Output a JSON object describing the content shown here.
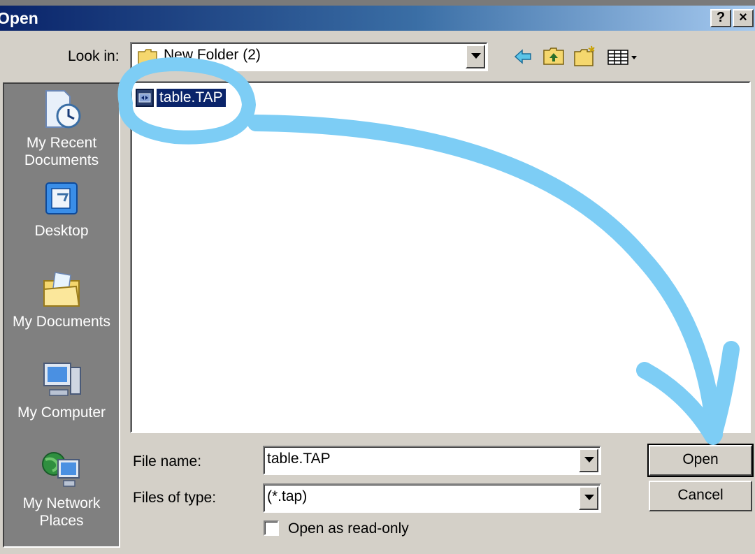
{
  "dialog": {
    "title": "Open",
    "help_button": "?",
    "close_button": "×"
  },
  "toolbar": {
    "look_in_label": "Look in:",
    "look_in_value": "New Folder (2)",
    "icons": [
      "back-arrow-icon",
      "up-folder-icon",
      "new-folder-icon",
      "view-menu-icon"
    ]
  },
  "places": [
    {
      "label": "My Recent Documents",
      "icon": "recent-documents-icon"
    },
    {
      "label": "Desktop",
      "icon": "desktop-icon"
    },
    {
      "label": "My Documents",
      "icon": "my-documents-icon"
    },
    {
      "label": "My Computer",
      "icon": "my-computer-icon"
    },
    {
      "label": "My Network Places",
      "icon": "network-places-icon"
    }
  ],
  "files": [
    {
      "name": "table.TAP",
      "selected": true
    }
  ],
  "form": {
    "file_name_label": "File name:",
    "file_name_value": "table.TAP",
    "file_type_label": "Files of type:",
    "file_type_value": "(*.tap)",
    "readonly_label": "Open as read-only",
    "readonly_checked": false
  },
  "buttons": {
    "open": "Open",
    "cancel": "Cancel"
  },
  "colors": {
    "annotation": "#7dcdf5",
    "selection": "#0a246a",
    "places_bg": "#808080"
  }
}
